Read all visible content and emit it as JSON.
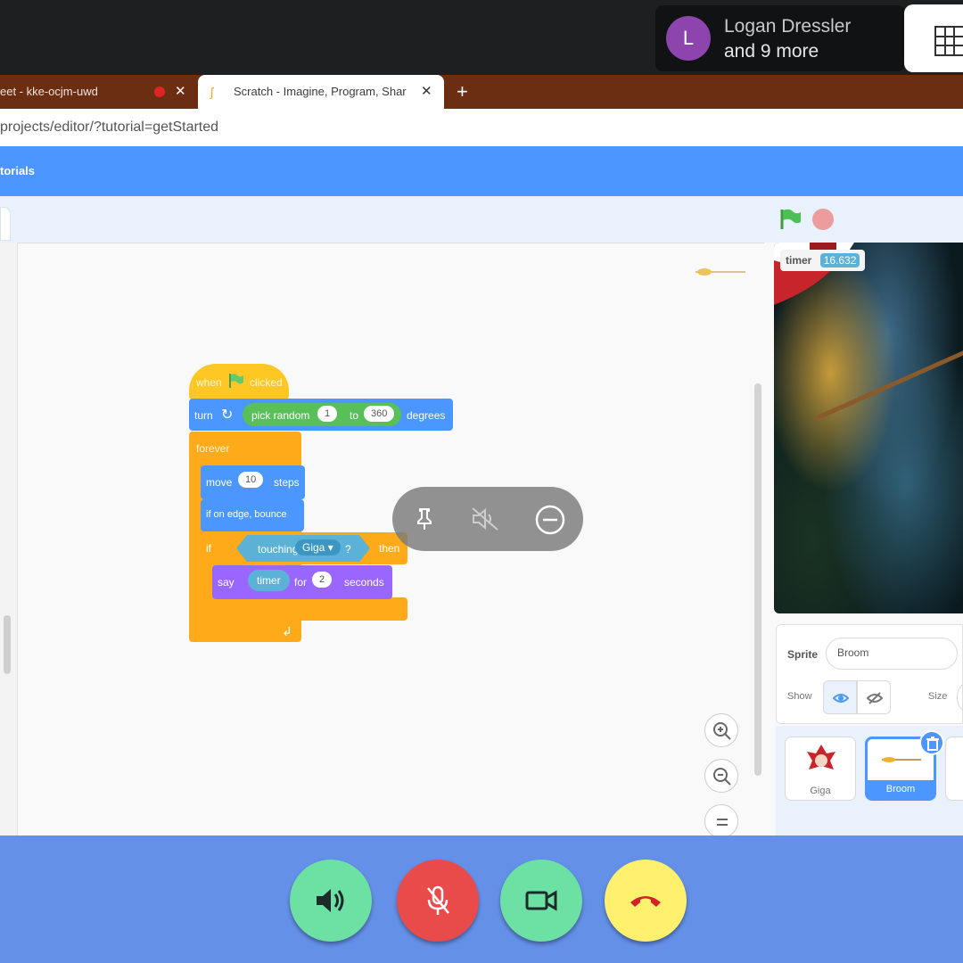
{
  "meet": {
    "participant_initial": "L",
    "participant_name": "Logan Dressler",
    "participant_more": "and 9 more"
  },
  "browser": {
    "tabs": [
      {
        "label": "eet - kke-ocjm-uwd",
        "recording": true
      },
      {
        "label": "Scratch - Imagine, Program, Shar",
        "active": true
      }
    ],
    "new_tab_label": "+",
    "url": "projects/editor/?tutorial=getStarted"
  },
  "scratch": {
    "menu": {
      "tutorials": "torials"
    },
    "blocks": {
      "hat_when": "when",
      "hat_clicked": "clicked",
      "turn": "turn",
      "pick_random": "pick random",
      "random_from": "1",
      "random_to_label": "to",
      "random_to": "360",
      "degrees": "degrees",
      "forever": "forever",
      "move": "move",
      "move_steps_value": "10",
      "steps": "steps",
      "bounce": "if on edge, bounce",
      "if": "if",
      "touching": "touching",
      "touching_target": "Giga",
      "question": "?",
      "then": "then",
      "say": "say",
      "say_value": "timer",
      "for": "for",
      "say_seconds_value": "2",
      "seconds": "seconds"
    },
    "stage": {
      "monitor_label": "timer",
      "monitor_value": "16.632"
    },
    "sprite_info": {
      "sprite_label": "Sprite",
      "sprite_name": "Broom",
      "show_label": "Show",
      "size_label": "Size"
    },
    "sprites": [
      {
        "name": "Giga",
        "selected": false
      },
      {
        "name": "Broom",
        "selected": true
      }
    ]
  },
  "colors": {
    "scratch_blue": "#4c97ff",
    "control_orange": "#ffab19",
    "looks_purple": "#9966ff",
    "operator_green": "#59c059",
    "sensing_blue": "#5cb1d6",
    "callbar_blue": "#6490e8"
  },
  "icons": {
    "overlay": [
      "pin-icon",
      "mute-icon",
      "remove-icon"
    ],
    "call_controls": [
      "speaker-icon",
      "mic-off-icon",
      "camera-icon",
      "hangup-icon"
    ]
  }
}
